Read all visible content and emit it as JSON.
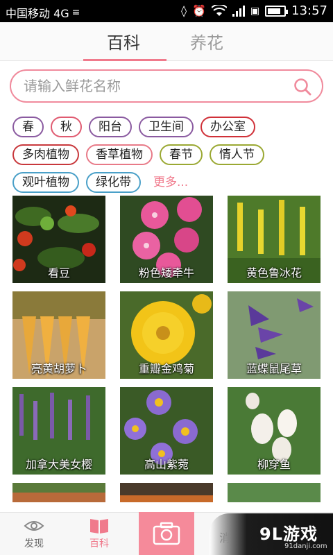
{
  "status_bar": {
    "carrier": "中国移动 4G",
    "time": "13:57",
    "network_badge": "4G",
    "battery_level": 0.8
  },
  "tabs": [
    {
      "label": "百科",
      "active": true
    },
    {
      "label": "养花",
      "active": false
    }
  ],
  "search": {
    "placeholder": "请输入鲜花名称",
    "value": ""
  },
  "tags": [
    {
      "label": "春",
      "color": "#8a5aa0"
    },
    {
      "label": "秋",
      "color": "#e05a70"
    },
    {
      "label": "阳台",
      "color": "#8a5aa0"
    },
    {
      "label": "卫生间",
      "color": "#8a5aa0"
    },
    {
      "label": "办公室",
      "color": "#d03038"
    },
    {
      "label": "多肉植物",
      "color": "#c8383c"
    },
    {
      "label": "香草植物",
      "color": "#e87a88"
    },
    {
      "label": "春节",
      "color": "#9aa832"
    },
    {
      "label": "情人节",
      "color": "#9aa832"
    },
    {
      "label": "观叶植物",
      "color": "#4aa0c8"
    },
    {
      "label": "绿化带",
      "color": "#4aa0c8"
    }
  ],
  "more_label": "更多...",
  "plants": [
    {
      "name": "看豆",
      "icon": "chili-plant-photo"
    },
    {
      "name": "粉色矮牵牛",
      "icon": "pink-petunia-photo"
    },
    {
      "name": "黄色鲁冰花",
      "icon": "yellow-lupine-photo"
    },
    {
      "name": "亮黄胡萝卜",
      "icon": "carrot-photo"
    },
    {
      "name": "重瓣金鸡菊",
      "icon": "coreopsis-photo"
    },
    {
      "name": "蓝蝶鼠尾草",
      "icon": "blue-salvia-photo"
    },
    {
      "name": "加拿大美女樱",
      "icon": "verbena-photo"
    },
    {
      "name": "高山紫菀",
      "icon": "aster-photo"
    },
    {
      "name": "柳穿鱼",
      "icon": "linaria-photo"
    }
  ],
  "bottom_nav": [
    {
      "label": "发现",
      "icon": "eye-icon",
      "active": false
    },
    {
      "label": "百科",
      "icon": "book-icon",
      "active": true
    },
    {
      "label": "",
      "icon": "camera-icon",
      "active": false
    },
    {
      "label": "消",
      "icon": "message-icon",
      "active": false
    }
  ],
  "watermark": {
    "logo": "9L游戏",
    "url": "91danji.com"
  },
  "colors": {
    "accent": "#f07a8c",
    "camera_bg": "#f58a9a"
  }
}
